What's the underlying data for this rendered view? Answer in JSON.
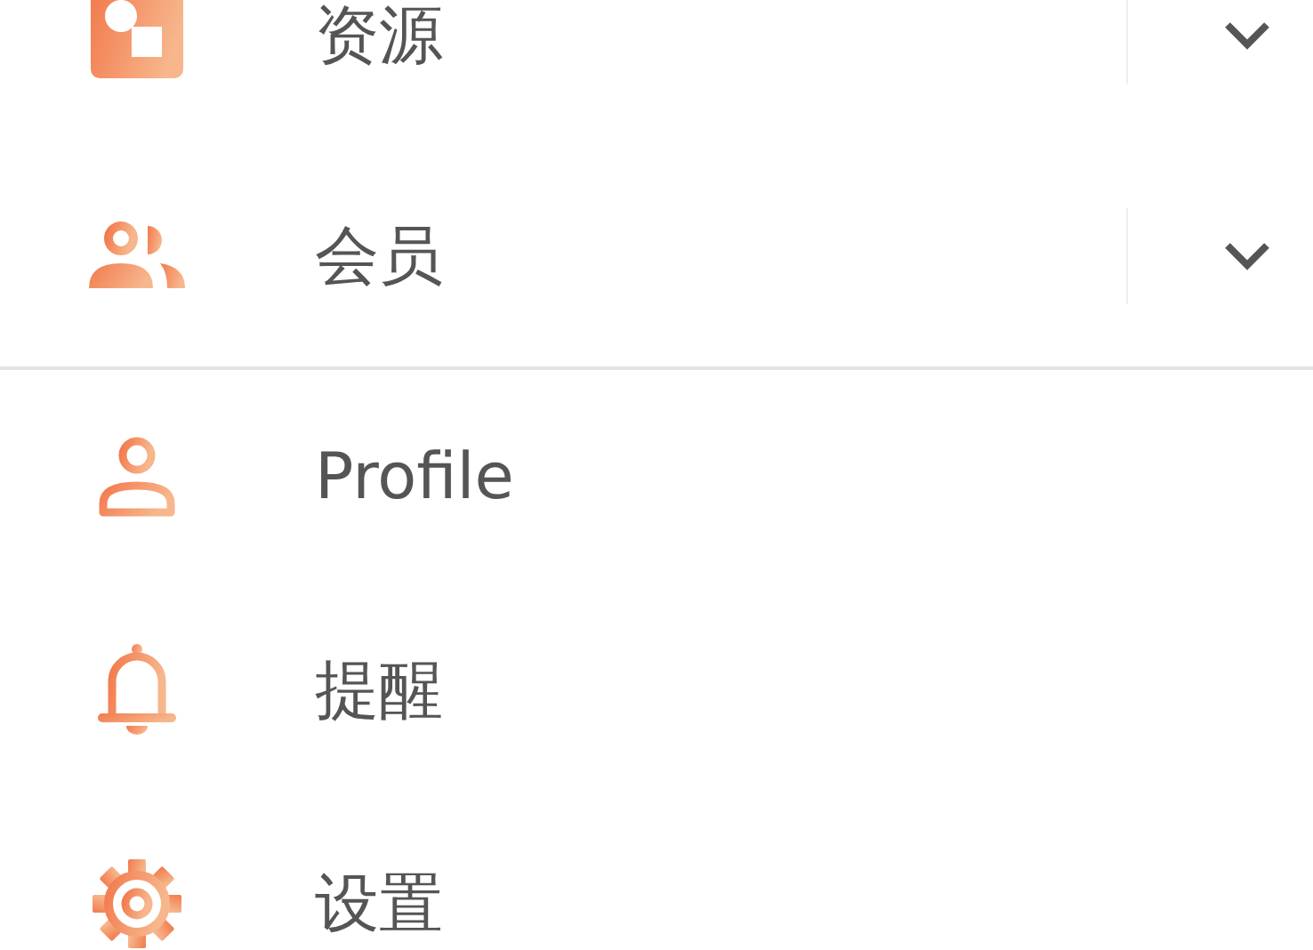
{
  "groups": [
    {
      "items": [
        {
          "label": "资源",
          "kind": "expandable",
          "expanded": false
        },
        {
          "label": "会员",
          "kind": "expandable",
          "expanded": false
        }
      ]
    },
    {
      "items": [
        {
          "label": "Profile",
          "kind": "link"
        },
        {
          "label": "提醒",
          "kind": "link"
        },
        {
          "label": "设置",
          "kind": "link"
        }
      ]
    }
  ]
}
